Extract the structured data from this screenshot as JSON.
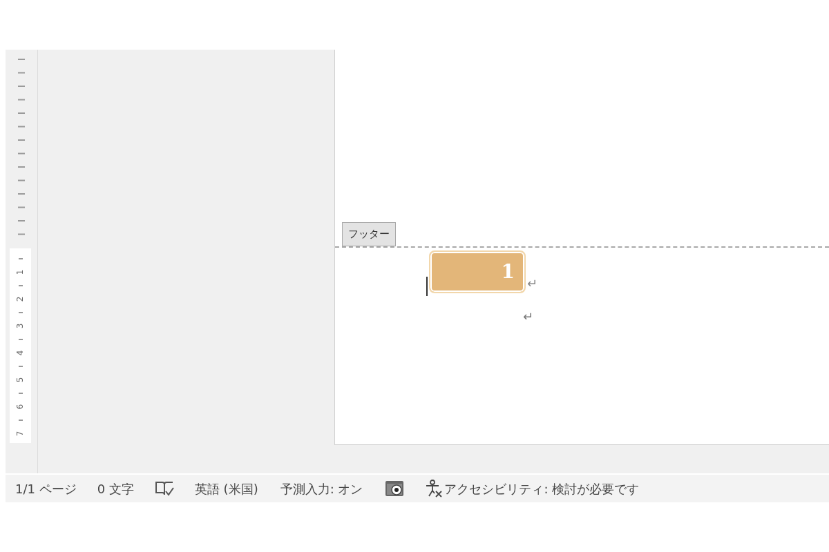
{
  "ruler": {
    "marks": [
      "1",
      "2",
      "3",
      "4",
      "5",
      "6",
      "7"
    ]
  },
  "page": {
    "footer_tab": "フッター",
    "page_number": "1",
    "paragraph_marks": [
      "↵",
      "↵"
    ]
  },
  "status_bar": {
    "page_count": "1/1 ページ",
    "word_count": "0 文字",
    "language": "英語 (米国)",
    "predictive_input": "予測入力: オン",
    "accessibility": "アクセシビリティ: 検討が必要です"
  }
}
